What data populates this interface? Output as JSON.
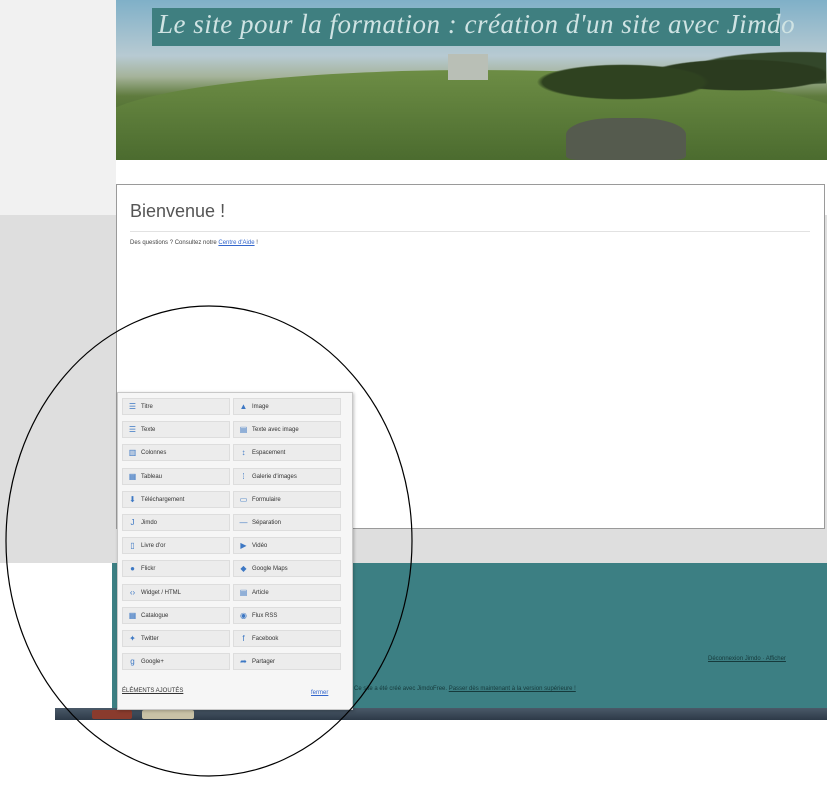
{
  "header": {
    "title": "Le site pour la formation : création d'un site avec Jimdo"
  },
  "content": {
    "heading": "Bienvenue !",
    "help_prefix": "Des questions ? Consultez notre",
    "help_link": "Centre d'Aide",
    "help_suffix": " !"
  },
  "palette": {
    "items": [
      {
        "label": "Titre",
        "icon": "title-icon"
      },
      {
        "label": "Image",
        "icon": "image-icon"
      },
      {
        "label": "Texte",
        "icon": "text-icon"
      },
      {
        "label": "Texte avec image",
        "icon": "text-image-icon"
      },
      {
        "label": "Colonnes",
        "icon": "columns-icon"
      },
      {
        "label": "Espacement",
        "icon": "spacing-icon"
      },
      {
        "label": "Tableau",
        "icon": "table-icon"
      },
      {
        "label": "Galerie d'images",
        "icon": "gallery-icon"
      },
      {
        "label": "Téléchargement",
        "icon": "download-icon"
      },
      {
        "label": "Formulaire",
        "icon": "form-icon"
      },
      {
        "label": "Jimdo",
        "icon": "jimdo-icon"
      },
      {
        "label": "Séparation",
        "icon": "separator-icon"
      },
      {
        "label": "Livre d'or",
        "icon": "guestbook-icon"
      },
      {
        "label": "Vidéo",
        "icon": "video-icon"
      },
      {
        "label": "Flickr",
        "icon": "flickr-icon"
      },
      {
        "label": "Google Maps",
        "icon": "map-icon"
      },
      {
        "label": "Widget / HTML",
        "icon": "code-icon"
      },
      {
        "label": "Article",
        "icon": "article-icon"
      },
      {
        "label": "Catalogue",
        "icon": "catalogue-icon"
      },
      {
        "label": "Flux RSS",
        "icon": "rss-icon"
      },
      {
        "label": "Twitter",
        "icon": "twitter-icon"
      },
      {
        "label": "Facebook",
        "icon": "facebook-icon"
      },
      {
        "label": "Google+",
        "icon": "googleplus-icon"
      },
      {
        "label": "Partager",
        "icon": "share-icon"
      }
    ],
    "more_label": "ÉLÉMENTS AJOUTÉS",
    "close_label": "fermer"
  },
  "footer": {
    "right_links": "Déconnexion  Jimdo · Afficher",
    "pro_text": "Ce site a été créé avec JimdoFree.",
    "pro_link": "Passer dès maintenant à la version supérieure !"
  },
  "colors": {
    "teal": "#3c7f83",
    "link": "#3366cc",
    "gray_band": "#dedede"
  }
}
